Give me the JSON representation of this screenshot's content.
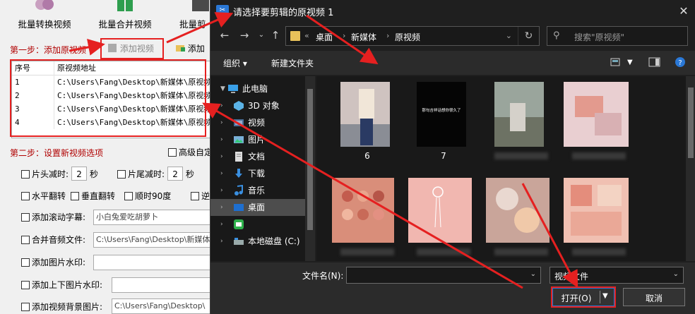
{
  "app": {
    "toolbar": [
      {
        "label": "批量转换视频",
        "icon": "convert-icon"
      },
      {
        "label": "批量合并视频",
        "icon": "merge-icon"
      },
      {
        "label": "批量剪",
        "icon": "film-icon"
      }
    ],
    "step1": "第一步：添加原视频",
    "add_video": "添加视频",
    "add_folder": "添加",
    "list_headers": [
      "序号",
      "原视频地址"
    ],
    "list_rows": [
      {
        "no": "1",
        "path": "C:\\Users\\Fang\\Desktop\\新媒体\\原视频\\"
      },
      {
        "no": "2",
        "path": "C:\\Users\\Fang\\Desktop\\新媒体\\原视频\\"
      },
      {
        "no": "3",
        "path": "C:\\Users\\Fang\\Desktop\\新媒体\\原视频\\"
      },
      {
        "no": "4",
        "path": "C:\\Users\\Fang\\Desktop\\新媒体\\原视频\\"
      }
    ],
    "step2": "第二步：设置新视频选项",
    "advanced": "高级自定",
    "head_cut": "片头减时:",
    "head_val": "2",
    "sec1": "秒",
    "tail_cut": "片尾减时:",
    "tail_val": "2",
    "sec2": "秒",
    "hflip": "水平翻转",
    "vflip": "垂直翻转",
    "rot90": "顺时90度",
    "reverse": "逆",
    "scroll_sub": "添加滚动字幕:",
    "scroll_sub_val": "小白兔爱吃胡萝卜",
    "merge_audio": "合并音频文件:",
    "merge_audio_val": "C:\\Users\\Fang\\Desktop\\新媒体",
    "img_watermark": "添加图片水印:",
    "tb_watermark": "添加上下图片水印:",
    "bg_image": "添加视频背景图片:",
    "bg_image_val": "C:\\Users\\Fang\\Desktop\\"
  },
  "dialog": {
    "title": "请选择要剪辑的原视频 1",
    "close": "✕",
    "breadcrumb": [
      "«",
      "桌面",
      "新媒体",
      "原视频"
    ],
    "search_placeholder": "搜索\"原视频\"",
    "organize": "组织 ▾",
    "new_folder": "新建文件夹",
    "tree": [
      {
        "label": "此电脑",
        "icon": "computer-icon",
        "expanded": true
      },
      {
        "label": "3D 对象",
        "icon": "3d-objects-icon"
      },
      {
        "label": "视频",
        "icon": "video-folder-icon"
      },
      {
        "label": "图片",
        "icon": "pictures-icon"
      },
      {
        "label": "文档",
        "icon": "documents-icon"
      },
      {
        "label": "下载",
        "icon": "download-icon"
      },
      {
        "label": "音乐",
        "icon": "music-icon"
      },
      {
        "label": "桌面",
        "icon": "desktop-icon",
        "selected": true
      },
      {
        "label": "",
        "icon": "app-icon"
      },
      {
        "label": "本地磁盘 (C:)",
        "icon": "drive-icon"
      }
    ],
    "thumb_overlay": "那句吉祥话想你很久了",
    "files": [
      {
        "name": "6"
      },
      {
        "name": "7"
      },
      {
        "name": ""
      },
      {
        "name": ""
      },
      {
        "name": ""
      },
      {
        "name": ""
      },
      {
        "name": ""
      },
      {
        "name": ""
      }
    ],
    "filename_label": "文件名(N):",
    "filename_value": "",
    "filetype": "视频文件",
    "open": "打开(O)",
    "cancel": "取消"
  },
  "colors": {
    "annotation_red": "#e52020",
    "accent_blue": "#2a78d6"
  }
}
